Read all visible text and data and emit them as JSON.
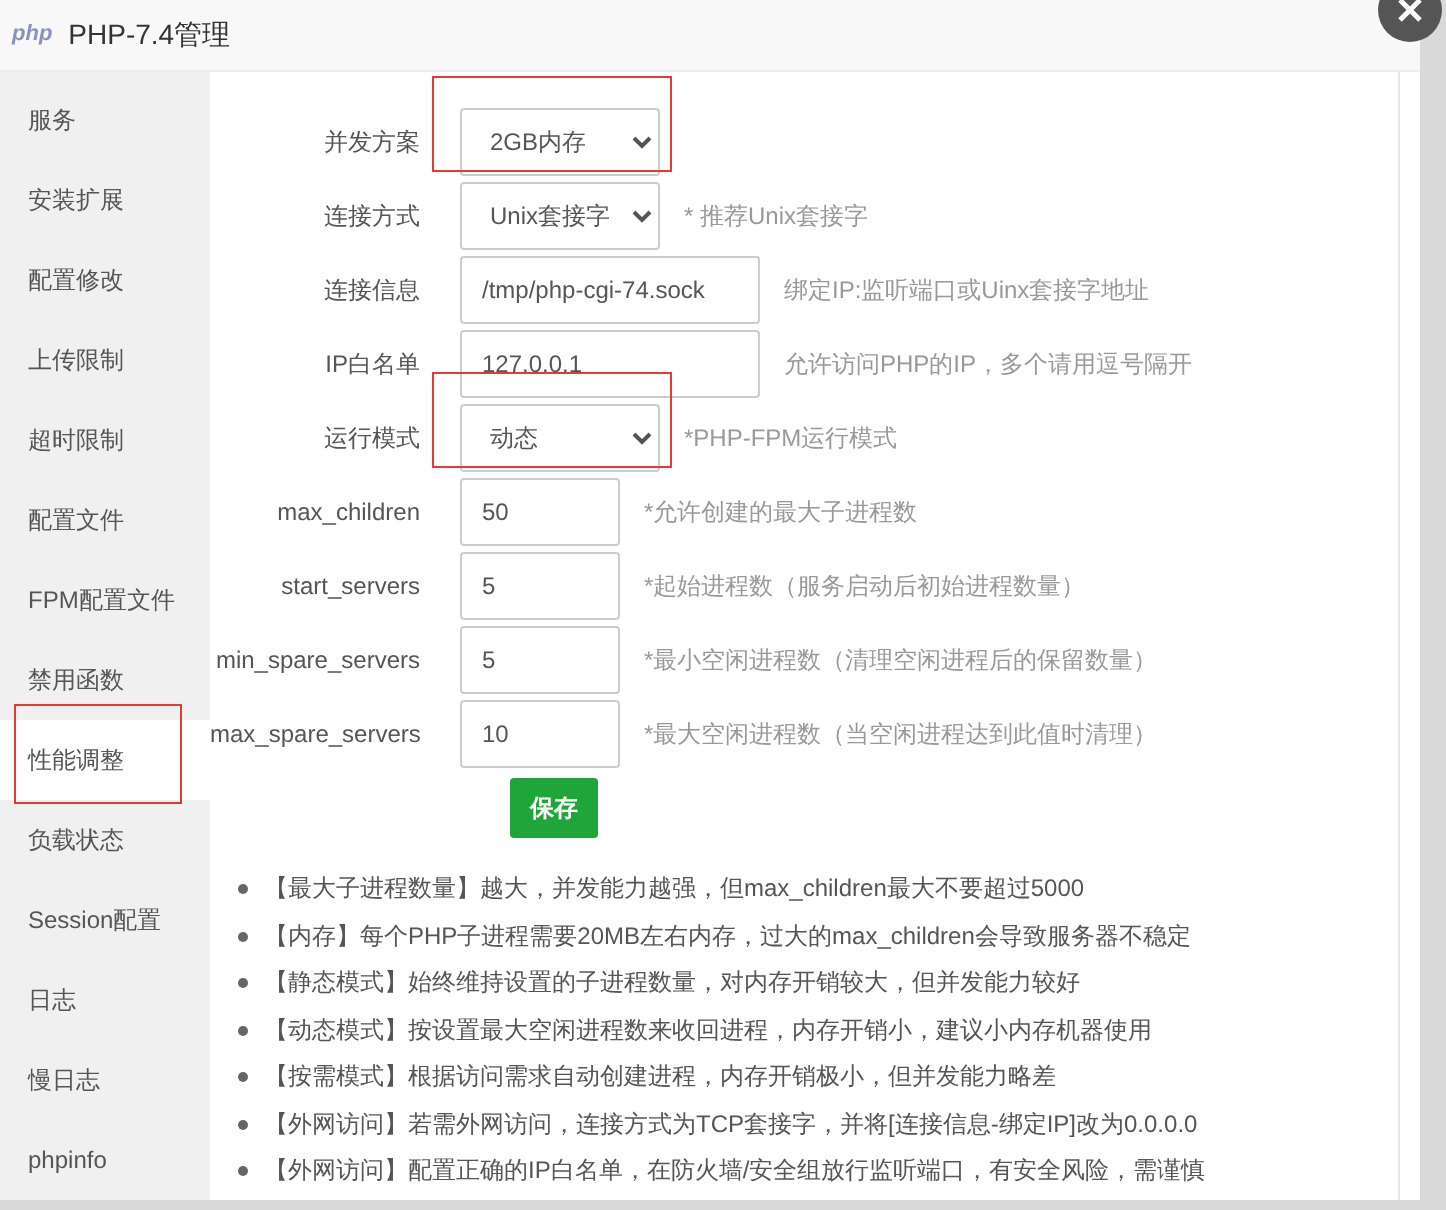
{
  "window": {
    "logo": "php",
    "title": "PHP-7.4管理"
  },
  "sidebar": {
    "items": [
      {
        "label": "服务",
        "selected": false,
        "highlighted": false
      },
      {
        "label": "安装扩展",
        "selected": false,
        "highlighted": false
      },
      {
        "label": "配置修改",
        "selected": false,
        "highlighted": false
      },
      {
        "label": "上传限制",
        "selected": false,
        "highlighted": false
      },
      {
        "label": "超时限制",
        "selected": false,
        "highlighted": false
      },
      {
        "label": "配置文件",
        "selected": false,
        "highlighted": false
      },
      {
        "label": "FPM配置文件",
        "selected": false,
        "highlighted": false
      },
      {
        "label": "禁用函数",
        "selected": false,
        "highlighted": false
      },
      {
        "label": "性能调整",
        "selected": true,
        "highlighted": true
      },
      {
        "label": "负载状态",
        "selected": false,
        "highlighted": false
      },
      {
        "label": "Session配置",
        "selected": false,
        "highlighted": false
      },
      {
        "label": "日志",
        "selected": false,
        "highlighted": false
      },
      {
        "label": "慢日志",
        "selected": false,
        "highlighted": false
      },
      {
        "label": "phpinfo",
        "selected": false,
        "highlighted": false
      }
    ]
  },
  "form": {
    "rows": [
      {
        "kind": "select",
        "label": "并发方案",
        "value": "2GB内存",
        "highlighted": true
      },
      {
        "kind": "select",
        "label": "连接方式",
        "value": "Unix套接字",
        "hint": "* 推荐Unix套接字",
        "highlighted": false
      },
      {
        "kind": "text",
        "label": "连接信息",
        "value": "/tmp/php-cgi-74.sock",
        "hint": "绑定IP:监听端口或Uinx套接字地址",
        "highlighted": false
      },
      {
        "kind": "text",
        "label": "IP白名单",
        "value": "127.0.0.1",
        "hint": "允许访问PHP的IP，多个请用逗号隔开",
        "highlighted": false
      },
      {
        "kind": "select",
        "label": "运行模式",
        "value": "动态",
        "hint": "*PHP-FPM运行模式",
        "highlighted": true
      },
      {
        "kind": "number",
        "label": "max_children",
        "value": "50",
        "hint": "*允许创建的最大子进程数",
        "highlighted": false
      },
      {
        "kind": "number",
        "label": "start_servers",
        "value": "5",
        "hint": "*起始进程数（服务启动后初始进程数量）",
        "highlighted": false
      },
      {
        "kind": "number",
        "label": "min_spare_servers",
        "value": "5",
        "hint": "*最小空闲进程数（清理空闲进程后的保留数量）",
        "highlighted": false
      },
      {
        "kind": "number",
        "label": "max_spare_servers",
        "value": "10",
        "hint": "*最大空闲进程数（当空闲进程达到此值时清理）",
        "highlighted": false
      }
    ],
    "save_button": "保存"
  },
  "notes": [
    "【最大子进程数量】越大，并发能力越强，但max_children最大不要超过5000",
    "【内存】每个PHP子进程需要20MB左右内存，过大的max_children会导致服务器不稳定",
    "【静态模式】始终维持设置的子进程数量，对内存开销较大，但并发能力较好",
    "【动态模式】按设置最大空闲进程数来收回进程，内存开销小，建议小内存机器使用",
    "【按需模式】根据访问需求自动创建进程，内存开销极小，但并发能力略差",
    "【外网访问】若需外网访问，连接方式为TCP套接字，并将[连接信息-绑定IP]改为0.0.0.0",
    "【外网访问】配置正确的IP白名单，在防火墙/安全组放行监听端口，有安全风险，需谨慎"
  ]
}
